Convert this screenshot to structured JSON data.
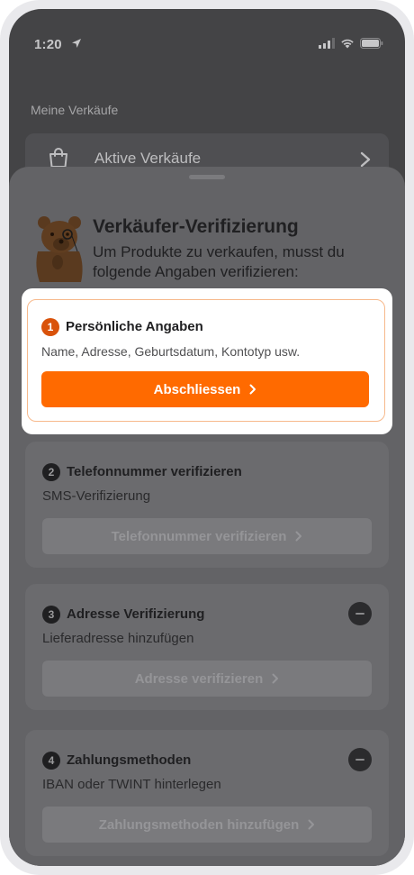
{
  "status_bar": {
    "time": "1:20"
  },
  "background": {
    "section_title": "Meine Verkäufe",
    "row_label": "Aktive Verkäufe"
  },
  "sheet": {
    "title": "Verkäufer-Verifizierung",
    "subtitle": "Um Produkte zu verkaufen, musst du folgende Angaben verifizieren:",
    "steps": [
      {
        "number": "1",
        "title": "Persönliche Angaben",
        "description": "Name, Adresse, Geburtsdatum, Kontotyp usw.",
        "button_label": "Abschliessen",
        "state": "active"
      },
      {
        "number": "2",
        "title": "Telefonnummer verifizieren",
        "description": "SMS-Verifizierung",
        "button_label": "Telefonnummer verifizieren",
        "state": "disabled"
      },
      {
        "number": "3",
        "title": "Adresse Verifizierung",
        "description": "Lieferadresse hinzufügen",
        "button_label": "Adresse verifizieren",
        "state": "disabled"
      },
      {
        "number": "4",
        "title": "Zahlungsmethoden",
        "description": "IBAN oder TWINT hinterlegen",
        "button_label": "Zahlungsmethoden hinzufügen",
        "state": "disabled"
      }
    ]
  },
  "colors": {
    "accent": "#ff6a00",
    "step_active": "#d9520a",
    "overlay_bg": "#444446",
    "sheet_bg": "#636366"
  },
  "icons": [
    "location-arrow-icon",
    "signal-icon",
    "wifi-icon",
    "battery-icon",
    "shopping-bag-icon",
    "chevron-right-icon",
    "minus-icon",
    "bear-mascot"
  ]
}
